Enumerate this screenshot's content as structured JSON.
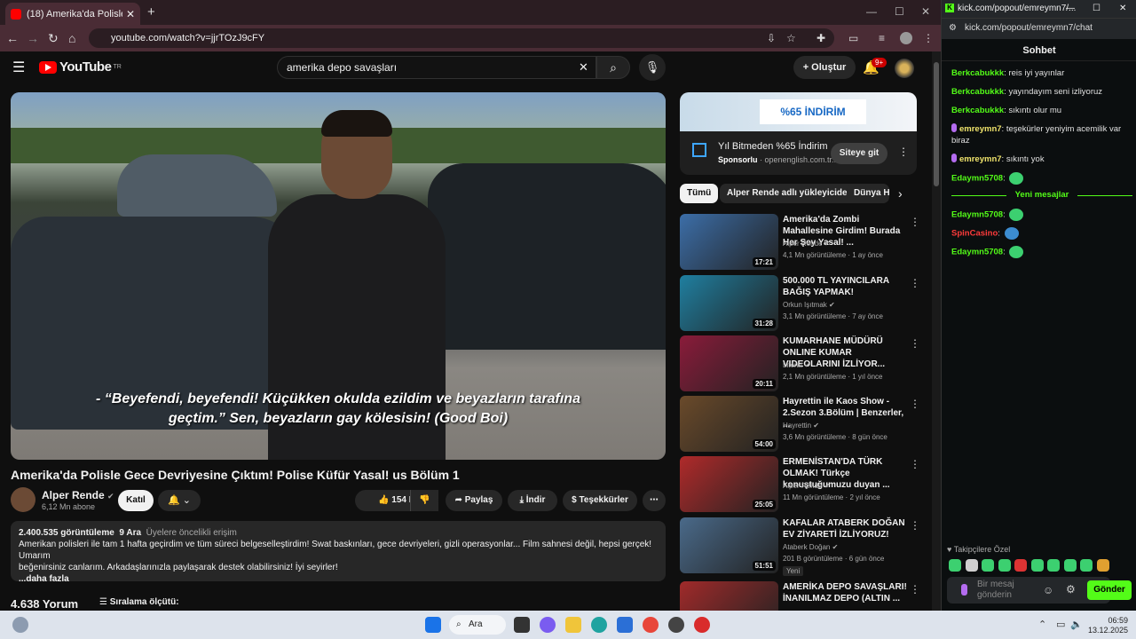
{
  "browser": {
    "tab_title": "(18) Amerika'da Polisle Gec",
    "url": "youtube.com/watch?v=jjrTOzJ9cFY"
  },
  "youtube": {
    "logo_text": "YouTube",
    "logo_region": "TR",
    "search_value": "amerika depo savaşları",
    "create_label": "Oluştur",
    "notif_count": "9+",
    "subtitle_line1": "- “Beyefendi, beyefendi! Küçükken okulda ezildim ve beyazların tarafına",
    "subtitle_line2": "geçtim.” Sen, beyazların gay kölesisin! (Good Boi)",
    "video_title": "Amerika'da Polisle Gece Devriyesine Çıktım! Polise Küfür Yasal! us Bölüm 1",
    "channel_name": "Alper Rende",
    "subscribers": "6,12 Mn abone",
    "join_label": "Katıl",
    "likes": "154 B",
    "share_label": "Paylaş",
    "download_label": "İndir",
    "thanks_label": "Teşekkürler",
    "views": "2.400.535 görüntüleme",
    "date": "9 Ara",
    "members_first": "Üyelere öncelikli erişim",
    "description_1": "Amerikan polisleri ile tam 1 hafta geçirdim ve tüm süreci belgeselleştirdim! Swat baskınları, gece devriyeleri, gizli operasyonlar... Film sahnesi değil, hepsi gerçek! Umarım",
    "description_2": "beğenirsiniz canlarım. Arkadaşlarınızla paylaşarak destek olabilirsiniz! İyi seyirler!",
    "more_label": "...daha fazla",
    "comment_count": "4.638 Yorum",
    "sort_label": "Sıralama ölçütü:"
  },
  "ad": {
    "banner": "%65 İNDİRİM",
    "title": "Yıl Bitmeden %65 İndirim",
    "sponsored": "Sponsorlu",
    "domain": "· openenglish.com.tr...",
    "button": "Siteye git"
  },
  "chips": [
    "Tümü",
    "Alper Rende adlı yükleyiciden",
    "Dünya H"
  ],
  "recommendations": [
    {
      "title": "Amerika'da Zombi Mahallesine Girdim! Burada Her Şey Yasal! ...",
      "channel": "Alper Rende",
      "meta": "4,1 Mn görüntüleme · 1 ay önce",
      "duration": "17:21",
      "color": "#3c6ea8"
    },
    {
      "title": "500.000 TL YAYINCILARA BAĞIŞ YAPMAK!",
      "channel": "Orkun Işıtmak",
      "meta": "3,1 Mn görüntüleme · 7 ay önce",
      "duration": "31:28",
      "color": "#1f7fa0"
    },
    {
      "title": "KUMARHANE MÜDÜRÜ ONLINE KUMAR VIDEOLARINI İZLİYOR...",
      "channel": "Literat",
      "meta": "2,1 Mn görüntüleme · 1 yıl önce",
      "duration": "20:11",
      "color": "#8a1b3a"
    },
    {
      "title": "Hayrettin ile Kaos Show - 2.Sezon 3.Bölüm | Benzerler, ...",
      "channel": "Hayrettin",
      "meta": "3,6 Mn görüntüleme · 8 gün önce",
      "duration": "54:00",
      "color": "#6a4a2a"
    },
    {
      "title": "ERMENİSTAN'DA TÜRK OLMAK! Türkçe konuştuğumuzu duyan ...",
      "channel": "Alper Rende",
      "meta": "11 Mn görüntüleme · 2 yıl önce",
      "duration": "25:05",
      "color": "#b02a2a"
    },
    {
      "title": "KAFALAR ATABERK DOĞAN EV ZİYARETİ İZLİYORUZ!",
      "channel": "Ataberk Doğan",
      "meta": "201 B görüntüleme · 6 gün önce",
      "duration": "51:51",
      "badge": "Yeni",
      "color": "#4a6a8a"
    },
    {
      "title": "AMERİKA DEPO SAVAŞLARI! İNANILMAZ DEPO (ALTIN ...",
      "channel": "",
      "meta": "",
      "duration": "",
      "color": "#a02a2a"
    }
  ],
  "kick": {
    "window_title": "kick.com/popout/emreymn7/...",
    "url": "kick.com/popout/emreymn7/chat",
    "header": "Sohbet",
    "new_messages": "Yeni mesajlar",
    "messages": [
      {
        "user": "Berkcabukkk",
        "text": "reis iyi yayınlar",
        "color": "#53fc18",
        "mic": false
      },
      {
        "user": "Berkcabukkk",
        "text": "yayındayım seni izliyoruz",
        "color": "#53fc18",
        "mic": false
      },
      {
        "user": "Berkcabukkk",
        "text": "sıkıntı olur mu",
        "color": "#53fc18",
        "mic": false
      },
      {
        "user": "emreymn7",
        "text": "teşekürler yeniyim acemilik var biraz",
        "color": "#f0e46c",
        "mic": true
      },
      {
        "user": "emreymn7",
        "text": "sıkıntı yok",
        "color": "#f0e46c",
        "mic": true
      },
      {
        "user": "Edaymn5708",
        "text": "",
        "color": "#53fc18",
        "mic": false
      },
      {
        "user": "Edaymn5708",
        "text": "",
        "color": "#53fc18",
        "mic": false
      },
      {
        "user": "SpinCasino",
        "text": "",
        "color": "#ff3b3b",
        "mic": false
      },
      {
        "user": "Edaymn5708",
        "text": "",
        "color": "#53fc18",
        "mic": false
      }
    ],
    "followers_label": "Takipçilere Özel",
    "input_placeholder": "Bir mesaj gönderin",
    "send_label": "Gönder"
  },
  "taskbar": {
    "search_label": "Ara",
    "time": "06:59",
    "date": "13.12.2025"
  }
}
